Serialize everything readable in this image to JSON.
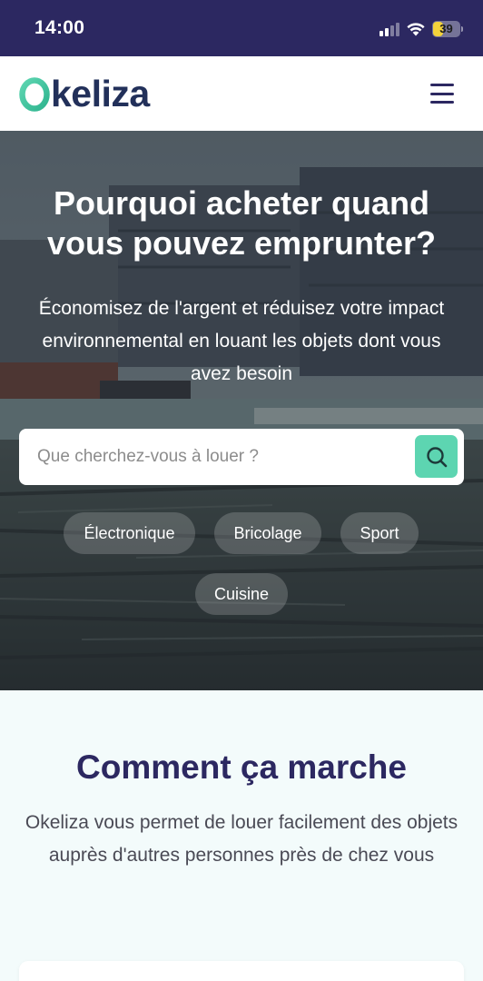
{
  "status_bar": {
    "time": "14:00",
    "battery_level": "39",
    "battery_fraction": 0.39,
    "icons": [
      "signal-icon",
      "wifi-icon",
      "battery-icon"
    ]
  },
  "header": {
    "logo_text": "keliza",
    "logo_mark": "O",
    "menu_icon": "hamburger-icon"
  },
  "hero": {
    "title": "Pourquoi acheter quand\nvous pouvez emprunter?",
    "subtitle": "Économisez de l'argent et réduisez votre impact environnemental en louant les objets dont vous avez besoin",
    "search": {
      "placeholder": "Que cherchez-vous à louer ?",
      "value": "",
      "button_icon": "search-icon"
    },
    "categories": [
      "Électronique",
      "Bricolage",
      "Sport",
      "Cuisine"
    ]
  },
  "how_it_works": {
    "title": "Comment ça marche",
    "description": "Okeliza vous permet de louer facilement des objets auprès d'autres personnes près de chez vous"
  },
  "colors": {
    "status_bar": "#2c2861",
    "brand_dark": "#2c2861",
    "logo_text": "#22305a",
    "accent_mint": "#5dd5b1",
    "section_bg": "#f3fbfb"
  }
}
